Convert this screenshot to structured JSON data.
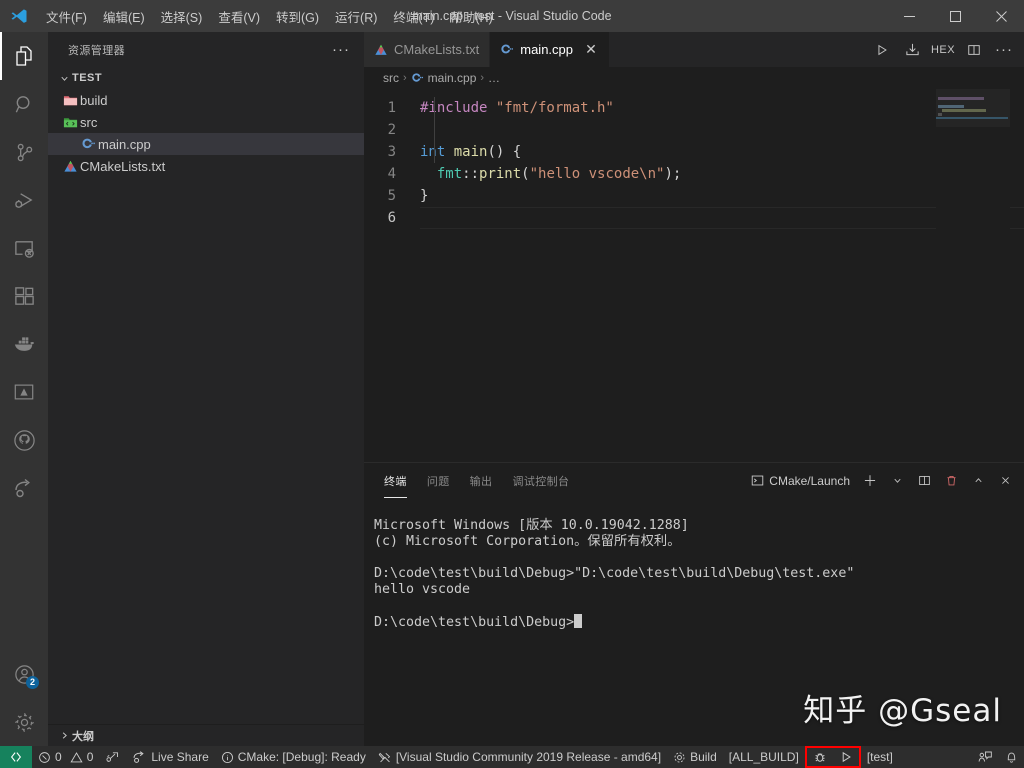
{
  "titlebar": {
    "logo_icon": "vscode-logo-icon",
    "title": "main.cpp - test - Visual Studio Code",
    "menus": [
      {
        "label": "文件(F)",
        "name": "menu-file"
      },
      {
        "label": "编辑(E)",
        "name": "menu-edit"
      },
      {
        "label": "选择(S)",
        "name": "menu-selection"
      },
      {
        "label": "查看(V)",
        "name": "menu-view"
      },
      {
        "label": "转到(G)",
        "name": "menu-go"
      },
      {
        "label": "运行(R)",
        "name": "menu-run"
      },
      {
        "label": "终端(T)",
        "name": "menu-terminal"
      },
      {
        "label": "帮助(H)",
        "name": "menu-help"
      }
    ],
    "minimize": "—",
    "maximize": "□",
    "close": "✕"
  },
  "activitybar": {
    "items": [
      {
        "name": "activity-explorer",
        "icon": "files-icon",
        "active": true
      },
      {
        "name": "activity-search",
        "icon": "search-icon",
        "active": false
      },
      {
        "name": "activity-source-control",
        "icon": "source-control-icon",
        "active": false
      },
      {
        "name": "activity-run-debug",
        "icon": "run-and-debug-icon",
        "active": false
      },
      {
        "name": "activity-remote-explorer",
        "icon": "remote-explorer-icon",
        "active": false
      },
      {
        "name": "activity-extensions",
        "icon": "extensions-icon",
        "active": false
      },
      {
        "name": "activity-docker",
        "icon": "docker-whale-icon",
        "active": false
      },
      {
        "name": "activity-cmake",
        "icon": "cmake-icon",
        "active": false
      },
      {
        "name": "activity-github",
        "icon": "github-icon",
        "active": false
      },
      {
        "name": "activity-live-share",
        "icon": "live-share-icon",
        "active": false
      }
    ],
    "account": {
      "name": "activity-account",
      "icon": "account-icon",
      "badge": "2"
    },
    "settings": {
      "name": "activity-settings",
      "icon": "gear-icon"
    }
  },
  "sidebar": {
    "header_title": "资源管理器",
    "more_actions": "···",
    "tree": [
      {
        "label": "TEST",
        "name": "tree-root-test",
        "type": "root",
        "expanded": true,
        "twisty": "⌄"
      },
      {
        "label": "build",
        "name": "tree-folder-build",
        "type": "folder",
        "icon": "folder-build-icon"
      },
      {
        "label": "src",
        "name": "tree-folder-src",
        "type": "folder",
        "icon": "folder-src-icon"
      },
      {
        "label": "main.cpp",
        "name": "tree-file-main-cpp",
        "type": "file",
        "icon": "cpp-file-icon",
        "selected": true
      },
      {
        "label": "CMakeLists.txt",
        "name": "tree-file-cmakelists",
        "type": "file",
        "icon": "cmake-file-icon"
      }
    ],
    "outline_label": "大纲",
    "outline_twisty": "›"
  },
  "editor": {
    "tabs": [
      {
        "label": "CMakeLists.txt",
        "name": "tab-cmakelists",
        "icon": "cmake-file-icon",
        "active": false
      },
      {
        "label": "main.cpp",
        "name": "tab-main-cpp",
        "icon": "cpp-file-icon",
        "active": true,
        "close": "✕"
      }
    ],
    "actions": [
      {
        "name": "editor-run-button",
        "icon": "play-icon",
        "label": "▷"
      },
      {
        "name": "editor-hex-save-button",
        "icon": "hex-save-icon",
        "label": ""
      },
      {
        "name": "editor-hex-button",
        "icon": "hex-label-icon",
        "label": "HEX"
      },
      {
        "name": "editor-split-button",
        "icon": "split-editor-icon",
        "label": ""
      },
      {
        "name": "editor-more-button",
        "icon": "more-actions-icon",
        "label": "···"
      }
    ],
    "breadcrumbs": [
      {
        "label": "src",
        "name": "breadcrumb-src",
        "icon": ""
      },
      {
        "label": "main.cpp",
        "name": "breadcrumb-main-cpp",
        "icon": "cpp-file-icon"
      },
      {
        "label": "…",
        "name": "breadcrumb-symbols",
        "icon": ""
      }
    ],
    "breadcrumb_separator": "›",
    "code_lines": [
      {
        "num": "1",
        "tokens": [
          {
            "t": "#include ",
            "c": "tok-pre"
          },
          {
            "t": "\"fmt/format.h\"",
            "c": "tok-str"
          }
        ]
      },
      {
        "num": "2",
        "tokens": []
      },
      {
        "num": "3",
        "tokens": [
          {
            "t": "int",
            "c": "tok-type"
          },
          {
            "t": " ",
            "c": "tok-plain"
          },
          {
            "t": "main",
            "c": "tok-fn"
          },
          {
            "t": "() {",
            "c": "tok-plain"
          }
        ]
      },
      {
        "num": "4",
        "tokens": [
          {
            "t": "  ",
            "c": "tok-plain"
          },
          {
            "t": "fmt",
            "c": "tok-ns"
          },
          {
            "t": "::",
            "c": "tok-plain"
          },
          {
            "t": "print",
            "c": "tok-fn"
          },
          {
            "t": "(",
            "c": "tok-plain"
          },
          {
            "t": "\"hello vscode\\n\"",
            "c": "tok-str"
          },
          {
            "t": ");",
            "c": "tok-plain"
          }
        ]
      },
      {
        "num": "5",
        "tokens": [
          {
            "t": "}",
            "c": "tok-plain"
          }
        ]
      },
      {
        "num": "6",
        "tokens": [],
        "current": true
      }
    ]
  },
  "panel": {
    "tabs": [
      {
        "label": "终端",
        "name": "panel-tab-terminal",
        "active": true
      },
      {
        "label": "问题",
        "name": "panel-tab-problems",
        "active": false
      },
      {
        "label": "输出",
        "name": "panel-tab-output",
        "active": false
      },
      {
        "label": "调试控制台",
        "name": "panel-tab-debug-console",
        "active": false
      }
    ],
    "terminal_selector": "CMake/Launch",
    "actions": [
      {
        "name": "panel-new-terminal-button",
        "icon": "plus-icon",
        "label": "＋"
      },
      {
        "name": "panel-terminal-dropdown-button",
        "icon": "chevron-down-icon",
        "label": "⌄"
      },
      {
        "name": "panel-split-terminal-button",
        "icon": "split-icon",
        "label": ""
      },
      {
        "name": "panel-kill-terminal-button",
        "icon": "trash-icon",
        "label": ""
      },
      {
        "name": "panel-maximize-button",
        "icon": "chevron-up-icon",
        "label": "⌃"
      },
      {
        "name": "panel-close-button",
        "icon": "close-icon",
        "label": "✕"
      }
    ],
    "terminal_output": [
      "Microsoft Windows [版本 10.0.19042.1288]",
      "(c) Microsoft Corporation。保留所有权利。",
      "",
      "D:\\code\\test\\build\\Debug>\"D:\\code\\test\\build\\Debug\\test.exe\"",
      "hello vscode",
      "",
      "D:\\code\\test\\build\\Debug>"
    ]
  },
  "watermark": "知乎 @Gseal",
  "statusbar": {
    "remote_icon": "remote-window-icon",
    "left": [
      {
        "name": "status-problems",
        "icon": "error-warning-icon",
        "label": "0  0",
        "errors": "0",
        "warnings": "0"
      },
      {
        "name": "status-ports",
        "icon": "ports-icon",
        "label": ""
      },
      {
        "name": "status-live-share",
        "icon": "live-share-icon",
        "label": "Live Share"
      },
      {
        "name": "status-cmake-build-variant",
        "icon": "info-icon",
        "label": "CMake: [Debug]: Ready"
      },
      {
        "name": "status-cmake-kit",
        "icon": "tools-icon",
        "label": "[Visual Studio Community 2019 Release - amd64]"
      },
      {
        "name": "status-cmake-build",
        "icon": "gear-icon",
        "label": "Build"
      },
      {
        "name": "status-cmake-build-target",
        "icon": "",
        "label": "[ALL_BUILD]"
      }
    ],
    "highlighted": [
      {
        "name": "status-cmake-debug-button",
        "icon": "bug-icon",
        "label": ""
      },
      {
        "name": "status-cmake-launch-button",
        "icon": "play-icon",
        "label": "▷"
      }
    ],
    "after_highlight": {
      "name": "status-cmake-launch-target",
      "label": "[test]"
    },
    "right": [
      {
        "name": "status-feedback",
        "icon": "feedback-icon",
        "label": ""
      },
      {
        "name": "status-notifications",
        "icon": "bell-icon",
        "label": ""
      }
    ],
    "accent_color": "#16825d",
    "highlight_box_color": "#ff0000"
  }
}
